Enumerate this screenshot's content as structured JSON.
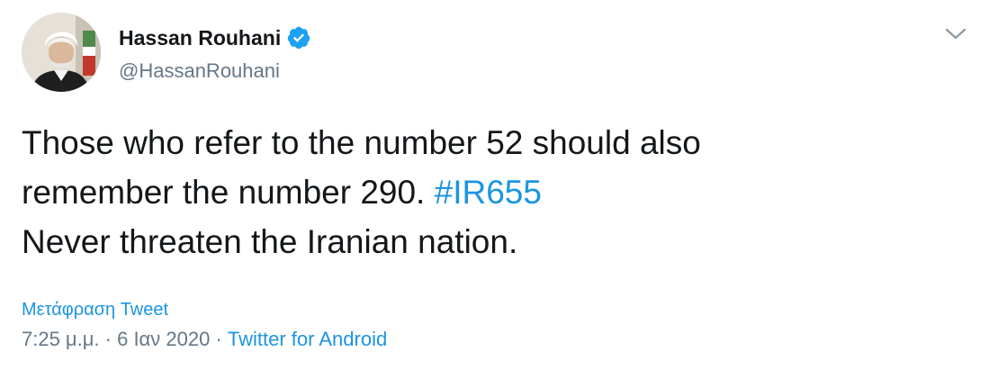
{
  "user": {
    "display_name": "Hassan Rouhani",
    "handle": "@HassanRouhani",
    "verified": true,
    "verified_icon": "verified-badge-icon",
    "avatar_icon": "avatar"
  },
  "menu": {
    "icon": "chevron-down-icon"
  },
  "tweet": {
    "line1": "Those who refer to the number 52 should also",
    "line2_text": "remember the number 290.",
    "hashtag": "#IR655",
    "line3": "Never threaten the Iranian nation."
  },
  "translate_label": "Μετάφραση Tweet",
  "meta": {
    "time": "7:25 μ.μ.",
    "separator1": "·",
    "date": "6 Ιαν 2020",
    "separator2": "·",
    "source": "Twitter for Android"
  },
  "colors": {
    "link": "#1b95e0",
    "text": "#14171a",
    "muted": "#657786"
  }
}
